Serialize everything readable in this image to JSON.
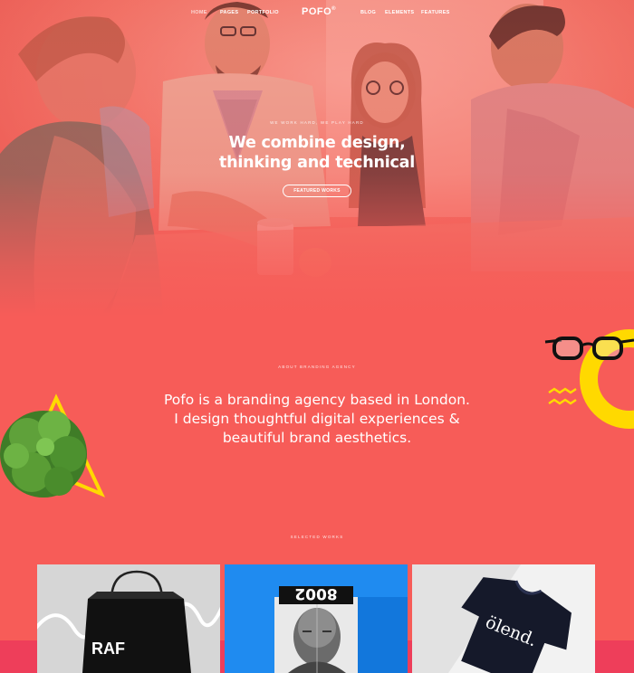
{
  "nav": {
    "left": [
      "HOME",
      "PAGES",
      "PORTFOLIO"
    ],
    "logo": "POFO",
    "logo_mark": "®",
    "right": [
      "BLOG",
      "ELEMENTS",
      "FEATURES"
    ]
  },
  "hero": {
    "eyebrow": "WE WORK HARD, WE PLAY HARD",
    "title_line1": "We combine design,",
    "title_line2": "thinking and technical",
    "button": "FEATURED WORKS"
  },
  "about": {
    "eyebrow": "ABOUT BRANDING AGENCY",
    "text": "Pofo is a branding agency based in London. I design thoughtful digital experiences & beautiful brand aesthetics."
  },
  "works": {
    "eyebrow": "SELECTED WORKS",
    "items": [
      {
        "bag_text": "RAF"
      },
      {
        "number_text": "8002"
      },
      {
        "shirt_text": "ölend."
      }
    ]
  },
  "colors": {
    "primary": "#f75c58",
    "accent_yellow": "#ffd900",
    "band": "#ee3e5a"
  }
}
